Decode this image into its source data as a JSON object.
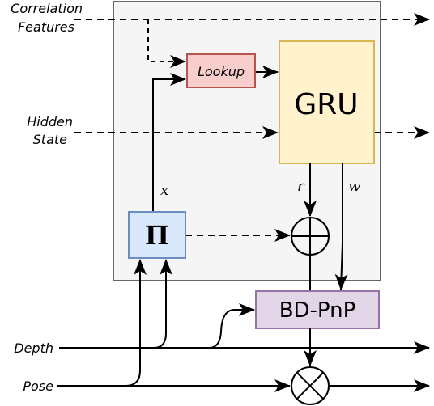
{
  "inputs": {
    "correlation_line1": "Correlation",
    "correlation_line2": "Features",
    "hidden_line1": "Hidden",
    "hidden_line2": "State",
    "depth": "Depth",
    "pose": "Pose"
  },
  "blocks": {
    "lookup": "Lookup",
    "gru": "GRU",
    "projection": "Π",
    "bdpnp": "BD-PnP"
  },
  "edge_labels": {
    "x": "x",
    "r": "r",
    "w": "w"
  },
  "colors": {
    "container_fill": "#f5f5f5",
    "container_stroke": "#666666",
    "lookup_fill": "#f8cecc",
    "lookup_stroke": "#b85450",
    "gru_fill": "#fff2cc",
    "gru_stroke": "#d6b656",
    "projection_fill": "#dae8fc",
    "projection_stroke": "#6c8ebf",
    "bdpnp_fill": "#e1d5e7",
    "bdpnp_stroke": "#9673a6"
  }
}
